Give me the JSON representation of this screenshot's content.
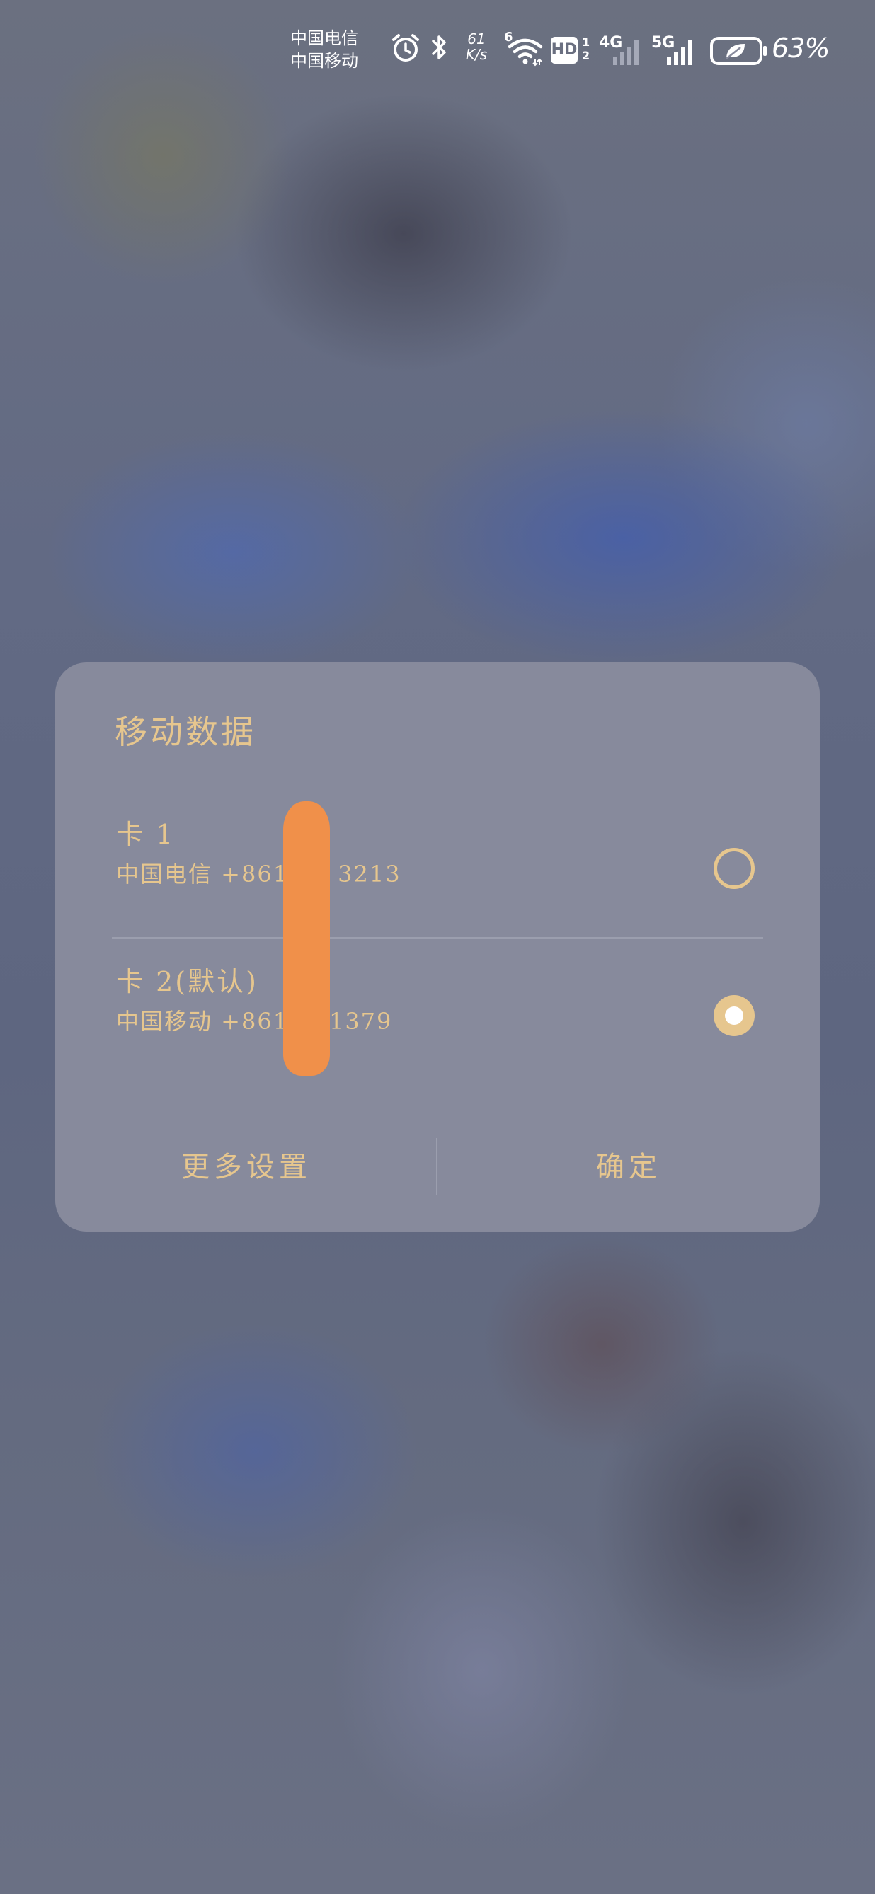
{
  "status_bar": {
    "carrier_1": "中国电信",
    "carrier_2": "中国移动",
    "speed_value": "61",
    "speed_unit": "K/s",
    "wifi_badge": "6",
    "hd_label": "HD",
    "hd_sim_1": "1",
    "hd_sim_2": "2",
    "network_1": "4G",
    "network_2": "5G",
    "battery_percent": "63%",
    "icons": [
      "alarm-icon",
      "bluetooth-icon",
      "wifi-icon",
      "signal-icon",
      "battery-saver-icon"
    ]
  },
  "dialog": {
    "title": "移动数据",
    "sims": [
      {
        "label": "卡 1",
        "number": "中国电信 +8619 1 3213",
        "selected": false
      },
      {
        "label": "卡 2(默认)",
        "number": "中国移动 +86183 1379",
        "selected": true
      }
    ],
    "more_settings_label": "更多设置",
    "confirm_label": "确定"
  },
  "colors": {
    "accent": "#e6c68e",
    "dialog_background": "#878a9c",
    "redaction": "#f0904a"
  }
}
